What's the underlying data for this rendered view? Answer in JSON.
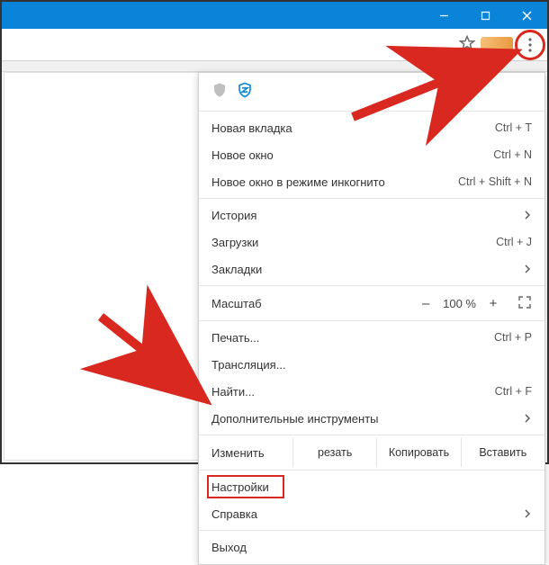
{
  "window": {
    "minimize": "–",
    "maximize": "❐",
    "close": "✕"
  },
  "menu_icon_tooltip": "Меню",
  "menu": {
    "new_tab": "Новая вкладка",
    "new_tab_sc": "Ctrl + T",
    "new_window": "Новое окно",
    "new_window_sc": "Ctrl + N",
    "incognito": "Новое окно в режиме инкогнито",
    "incognito_sc": "Ctrl + Shift + N",
    "history": "История",
    "downloads": "Загрузки",
    "downloads_sc": "Ctrl + J",
    "bookmarks": "Закладки",
    "zoom_label": "Масштаб",
    "zoom_minus": "–",
    "zoom_value": "100 %",
    "zoom_plus": "+",
    "print": "Печать...",
    "print_sc": "Ctrl + P",
    "cast": "Трансляция...",
    "find": "Найти...",
    "find_sc": "Ctrl + F",
    "more_tools": "Дополнительные инструменты",
    "edit_label": "Изменить",
    "cut": "резать",
    "copy": "Копировать",
    "paste": "Вставить",
    "settings": "Настройки",
    "help": "Справка",
    "exit": "Выход"
  }
}
